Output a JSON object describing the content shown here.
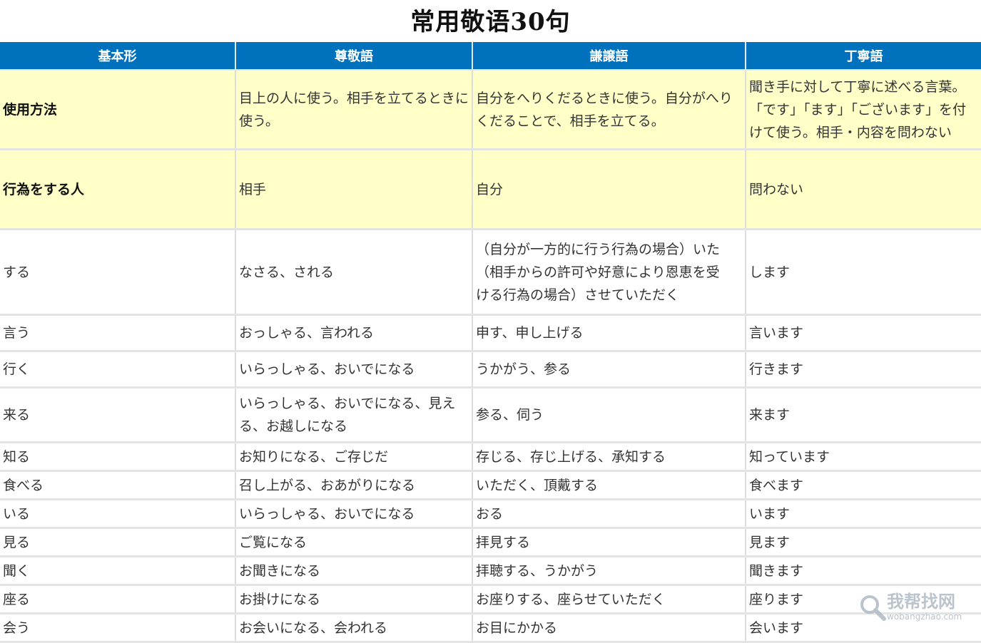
{
  "page": {
    "title": "常用敬语30句"
  },
  "table": {
    "headers": [
      "基本形",
      "尊敬語",
      "謙譲語",
      "丁寧語"
    ],
    "info_rows": [
      {
        "cells": [
          "使用方法",
          "目上の人に使う。相手を立てるときに使う。",
          "自分をへりくだるときに使う。自分がへりくだることで、相手を立てる。",
          "聞き手に対して丁寧に述べる言葉。「です」「ます」「ございます」を付けて使う。相手・内容を問わない"
        ]
      },
      {
        "cells": [
          "行為をする人",
          "相手",
          "自分",
          "問わない"
        ]
      }
    ],
    "rows": [
      {
        "cells": [
          "する",
          "なさる、される",
          "（自分が一方的に行う行為の場合）いた",
          "します"
        ],
        "extra_lines": [
          "（相手からの許可や好意により恩恵を受",
          "ける行為の場合）させていただく"
        ]
      },
      {
        "cells": [
          "言う",
          "おっしゃる、言われる",
          "申す、申し上げる",
          "言います"
        ]
      },
      {
        "cells": [
          "行く",
          "いらっしゃる、おいでになる",
          "うかがう、参る",
          "行きます"
        ]
      },
      {
        "cells": [
          "来る",
          "いらっしゃる、おいでになる、見える、お越しになる",
          "参る、伺う",
          "来ます"
        ]
      },
      {
        "cells": [
          "知る",
          "お知りになる、ご存じだ",
          "存じる、存じ上げる、承知する",
          "知っています"
        ]
      },
      {
        "cells": [
          "食べる",
          "召し上がる、おあがりになる",
          "いただく、頂戴する",
          "食べます"
        ]
      },
      {
        "cells": [
          "いる",
          "いらっしゃる、おいでになる",
          "おる",
          "います"
        ]
      },
      {
        "cells": [
          "見る",
          "ご覧になる",
          "拝見する",
          "見ます"
        ]
      },
      {
        "cells": [
          "聞く",
          "お聞きになる",
          "拝聴する、うかがう",
          "聞きます"
        ]
      },
      {
        "cells": [
          "座る",
          "お掛けになる",
          "お座りする、座らせていただく",
          "座ります"
        ]
      },
      {
        "cells": [
          "会う",
          "お会いになる、会われる",
          "お目にかかる",
          "会います"
        ]
      }
    ]
  },
  "watermark": {
    "text": "我帮找网",
    "url": "wobangzhao.com",
    "icon": "magnifier-icon",
    "color": "#b0b9c4"
  },
  "colors": {
    "header_bg": "#0071bc",
    "info_bg": "#ffffc8"
  }
}
